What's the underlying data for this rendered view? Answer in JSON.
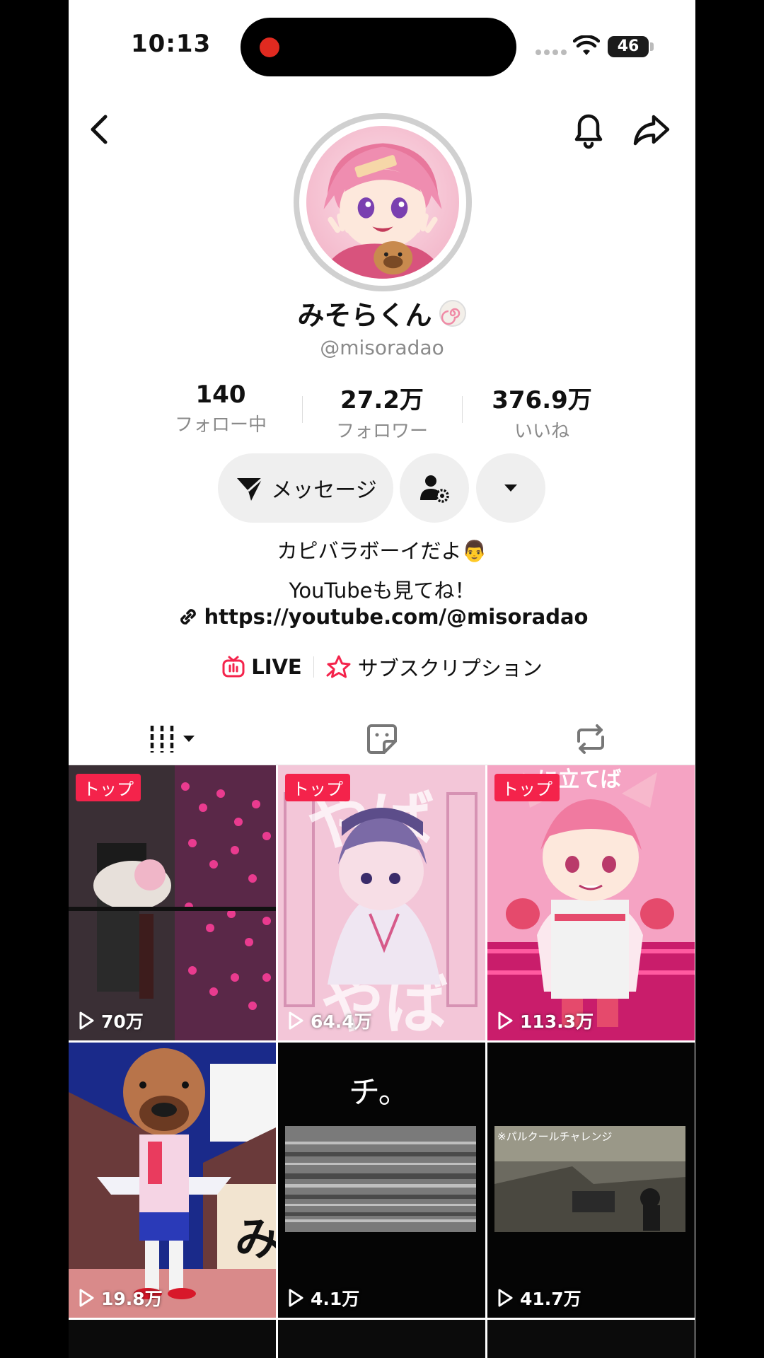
{
  "status_bar": {
    "time": "10:13",
    "battery": "46"
  },
  "profile": {
    "display_name": "みそらくん",
    "handle": "@misoradao",
    "stats": [
      {
        "value": "140",
        "label": "フォロー中"
      },
      {
        "value": "27.2万",
        "label": "フォロワー"
      },
      {
        "value": "376.9万",
        "label": "いいね"
      }
    ],
    "message_button": "メッセージ",
    "bio_line1": "カピバラボーイだよ👨",
    "bio_line2": "YouTubeも見てね！",
    "link": "https://youtube.com/@misoradao",
    "live_label": "LIVE",
    "subscription_label": "サブスクリプション"
  },
  "videos": [
    {
      "badge": "トップ",
      "views": "70万"
    },
    {
      "badge": "トップ",
      "views": "64.4万"
    },
    {
      "badge": "トップ",
      "views": "113.3万"
    },
    {
      "badge": "",
      "views": "19.8万"
    },
    {
      "badge": "",
      "views": "4.1万",
      "overlay_title": "チ。"
    },
    {
      "badge": "",
      "views": "41.7万",
      "overlay_title": "※パルクールチャレンジ"
    }
  ],
  "colors": {
    "accent": "#f4234b",
    "live": "#f4234b"
  }
}
